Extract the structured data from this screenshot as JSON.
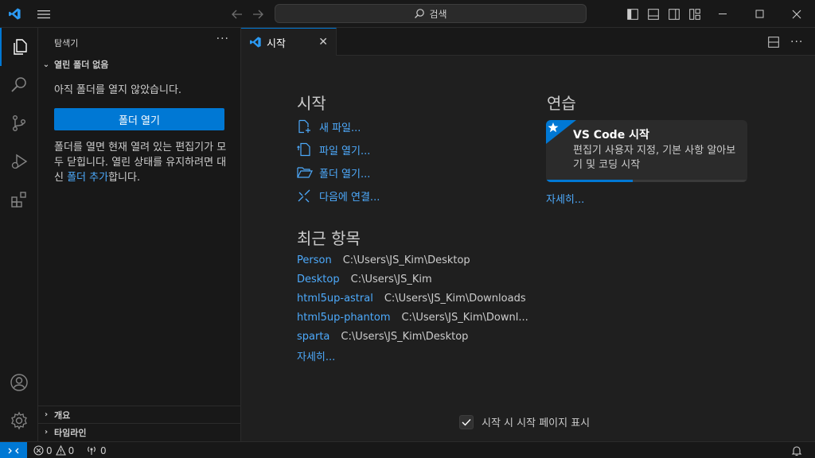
{
  "titlebar": {
    "search_label": "검색"
  },
  "sidebar": {
    "title": "탐색기",
    "more": "···",
    "section_open_folder": "열린 폴더 없음",
    "no_folder_text": "아직 폴더를 열지 않았습니다.",
    "open_folder_button": "폴더 열기",
    "info_text_1": "폴더를 열면 현재 열려 있는 편집기가 모두 닫힙니다. 열린 상태를 유지하려면 대신 ",
    "info_link": "폴더 추가",
    "info_text_2": "합니다.",
    "section_outline": "개요",
    "section_timeline": "타임라인"
  },
  "tab": {
    "label": "시작",
    "close": "✕"
  },
  "welcome": {
    "start_heading": "시작",
    "start_items": [
      {
        "label": "새 파일...",
        "icon": "new-file-icon"
      },
      {
        "label": "파일 열기...",
        "icon": "open-file-icon"
      },
      {
        "label": "폴더 열기...",
        "icon": "open-folder-icon"
      },
      {
        "label": "다음에 연결...",
        "icon": "remote-connect-icon"
      }
    ],
    "recent_heading": "최근 항목",
    "recent_items": [
      {
        "name": "Person",
        "path": "C:\\Users\\JS_Kim\\Desktop"
      },
      {
        "name": "Desktop",
        "path": "C:\\Users\\JS_Kim"
      },
      {
        "name": "html5up-astral",
        "path": "C:\\Users\\JS_Kim\\Downloads"
      },
      {
        "name": "html5up-phantom",
        "path": "C:\\Users\\JS_Kim\\Downl..."
      },
      {
        "name": "sparta",
        "path": "C:\\Users\\JS_Kim\\Desktop"
      }
    ],
    "recent_more": "자세히...",
    "walkthrough_heading": "연습",
    "walkthrough_title": "VS Code 시작",
    "walkthrough_desc": "편집기 사용자 지정, 기본 사항 알아보기 및 코딩 시작",
    "walkthrough_progress": 0.43,
    "walkthrough_more": "자세히...",
    "show_on_startup": "시작 시 시작 페이지 표시",
    "show_on_startup_checked": true
  },
  "statusbar": {
    "errors": "0",
    "warnings": "0",
    "ports": "0"
  },
  "colors": {
    "accent": "#0078d4",
    "link": "#4daafc",
    "background": "#1f1f1f",
    "chrome": "#181818"
  }
}
